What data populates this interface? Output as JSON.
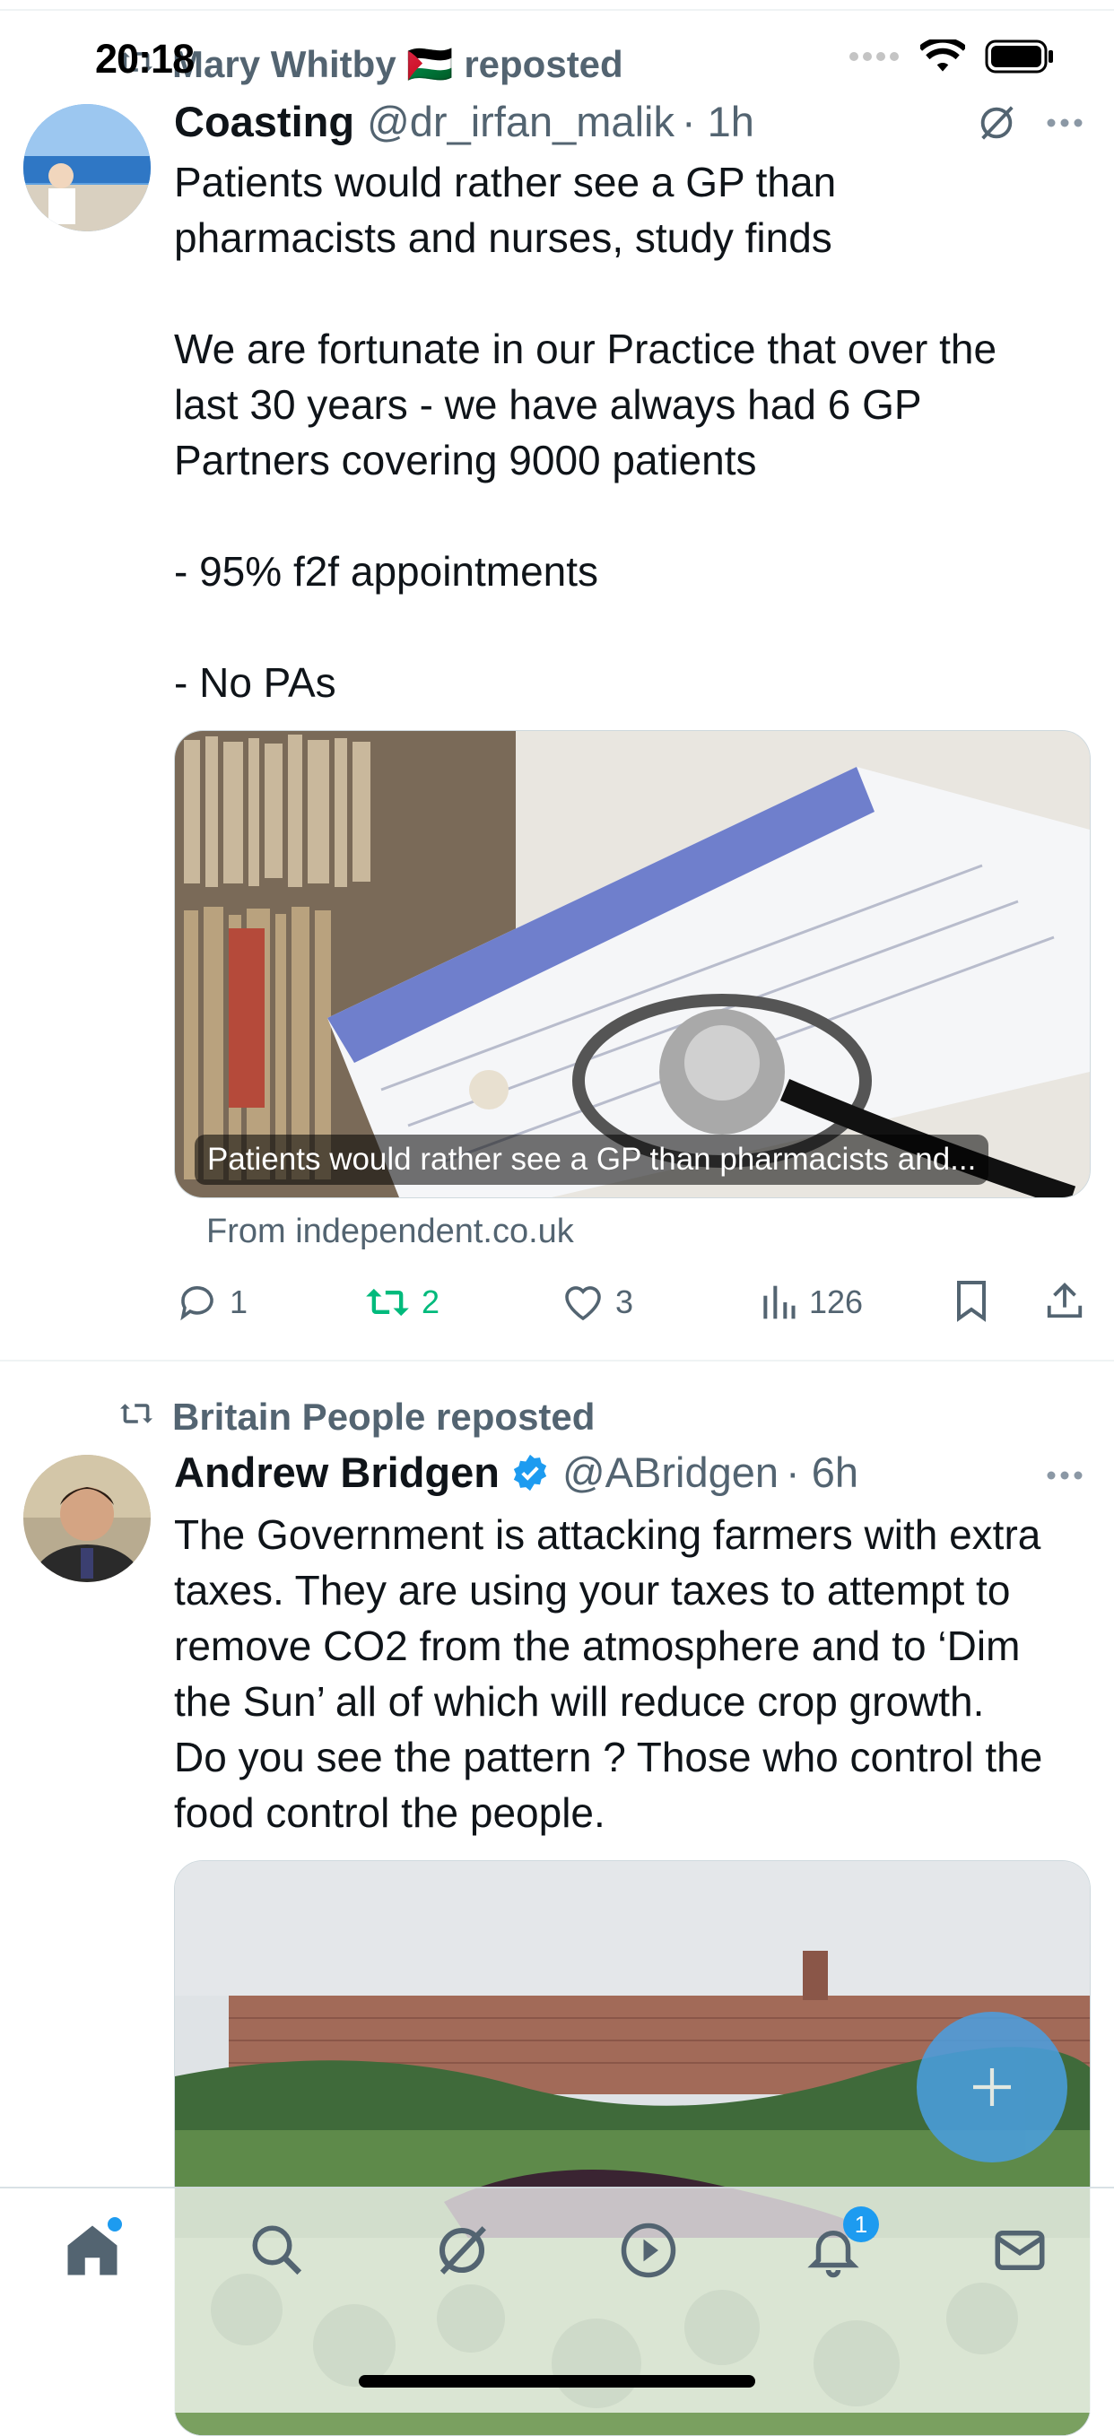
{
  "status_bar": {
    "time": "20:18"
  },
  "tweets": [
    {
      "repost_by": "Mary Whitby 🇵🇸 reposted",
      "name": "Coasting",
      "handle": "@dr_irfan_malik",
      "time": "· 1h",
      "text": "Patients would rather see a GP than\npharmacists and nurses, study finds\n\nWe are fortunate in our Practice that over the\nlast 30 years - we have always had 6 GP\nPartners covering 9000 patients\n\n- 95% f2f appointments\n\n- No PAs",
      "card_caption": "Patients would rather see a GP than pharmacists and...",
      "card_source": "From independent.co.uk",
      "replies": "1",
      "reposts": "2",
      "likes": "3",
      "views": "126"
    },
    {
      "repost_by": "Britain People reposted",
      "name": "Andrew Bridgen",
      "handle": "@ABridgen",
      "time": "· 6h",
      "text": "The Government is attacking farmers with extra\ntaxes. They are using your taxes to attempt to\nremove CO2 from the atmosphere and to ‘Dim\nthe Sun’ all of which will reduce crop growth.\nDo you see the pattern ? Those who control the\nfood control the people."
    }
  ],
  "tabbar": {
    "items": [
      "home-icon",
      "search-icon",
      "grok-icon",
      "video-icon",
      "notifications-icon",
      "messages-icon"
    ],
    "notification_badge": "1"
  },
  "colors": {
    "accent": "#1d9bf0",
    "repost_green": "#00ba7c",
    "muted": "#536471"
  }
}
